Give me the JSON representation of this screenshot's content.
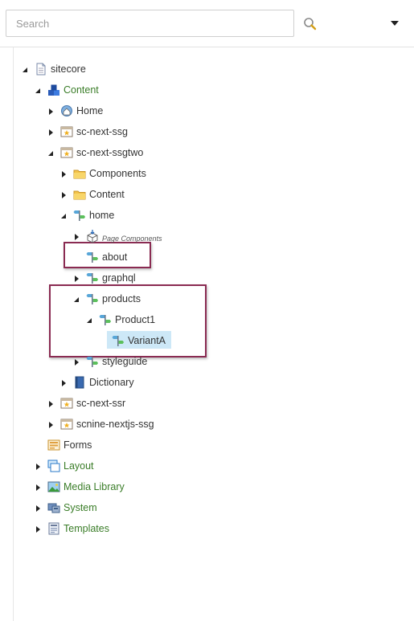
{
  "search": {
    "placeholder": "Search",
    "value": ""
  },
  "icons": {
    "search": "magnifier-icon",
    "dropdown": "caret-down-icon",
    "page": "page-icon",
    "content": "cubes-icon",
    "home": "globe-house-icon",
    "site": "site-star-icon",
    "folder": "folder-icon",
    "route": "route-icon",
    "page_components": "download-box-icon",
    "dictionary": "book-icon",
    "forms": "form-icon",
    "layout": "layout-icon",
    "media": "image-icon",
    "system": "system-icon",
    "templates": "templates-icon"
  },
  "tree": {
    "sitecore": "sitecore",
    "content": "Content",
    "home": "Home",
    "sc_next_ssg": "sc-next-ssg",
    "sc_next_ssgtwo": "sc-next-ssgtwo",
    "components": "Components",
    "content_folder": "Content",
    "home_route": "home",
    "page_components": "Page Components",
    "about": "about",
    "graphql": "graphql",
    "products": "products",
    "product1": "Product1",
    "varianta": "VariantA",
    "styleguide": "styleguide",
    "dictionary": "Dictionary",
    "sc_next_ssr": "sc-next-ssr",
    "scnine_nextjs_ssg": "scnine-nextjs-ssg",
    "forms": "Forms",
    "layout": "Layout",
    "media_library": "Media Library",
    "system": "System",
    "templates": "Templates"
  },
  "colors": {
    "highlight_border": "#8a2b52",
    "selection": "#cde8f7",
    "green_label": "#3a7d28"
  }
}
